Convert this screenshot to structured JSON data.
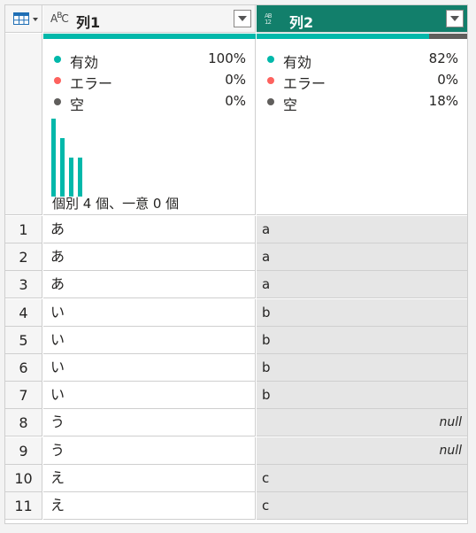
{
  "columns": [
    {
      "name": "列1",
      "type_icon": "abc-text-type-icon",
      "quality": {
        "valid_label": "有効",
        "valid_pct": "100%",
        "error_label": "エラー",
        "error_pct": "0%",
        "empty_label": "空",
        "empty_pct": "0%"
      },
      "quality_bar": {
        "valid_fraction": 1.0,
        "empty_fraction": 0.0
      },
      "histogram": [
        4,
        3,
        2,
        2
      ],
      "distinct_text": "個別 4 個、一意 0 個"
    },
    {
      "name": "列2",
      "type_icon": "any-type-icon",
      "quality": {
        "valid_label": "有効",
        "valid_pct": "82%",
        "error_label": "エラー",
        "error_pct": "0%",
        "empty_label": "空",
        "empty_pct": "18%"
      },
      "quality_bar": {
        "valid_fraction": 0.82,
        "empty_fraction": 0.18
      }
    }
  ],
  "colors": {
    "valid": "#01b8aa",
    "error": "#fd625e",
    "empty": "#605e5c",
    "selected_header": "#127f6b"
  },
  "rows": [
    {
      "n": "1",
      "c1": "あ",
      "c2": "a"
    },
    {
      "n": "2",
      "c1": "あ",
      "c2": "a"
    },
    {
      "n": "3",
      "c1": "あ",
      "c2": "a"
    },
    {
      "n": "4",
      "c1": "い",
      "c2": "b"
    },
    {
      "n": "5",
      "c1": "い",
      "c2": "b"
    },
    {
      "n": "6",
      "c1": "い",
      "c2": "b"
    },
    {
      "n": "7",
      "c1": "い",
      "c2": "b"
    },
    {
      "n": "8",
      "c1": "う",
      "c2": "null"
    },
    {
      "n": "9",
      "c1": "う",
      "c2": "null"
    },
    {
      "n": "10",
      "c1": "え",
      "c2": "c"
    },
    {
      "n": "11",
      "c1": "え",
      "c2": "c"
    }
  ]
}
